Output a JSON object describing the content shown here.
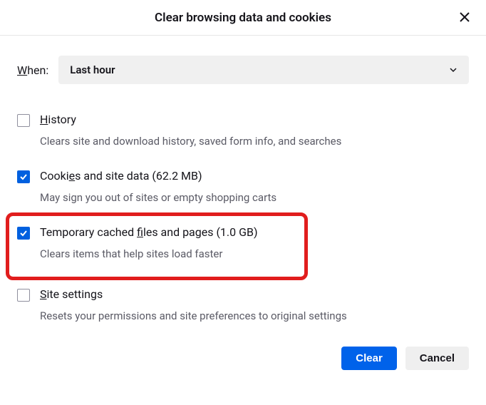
{
  "dialog": {
    "title": "Clear browsing data and cookies"
  },
  "when": {
    "label_pre": "W",
    "label_post": "hen:",
    "selected": "Last hour"
  },
  "options": {
    "history": {
      "underline": "H",
      "rest": "istory",
      "desc": "Clears site and download history, saved form info, and searches"
    },
    "cookies": {
      "pre": "Cooki",
      "underline": "e",
      "post": "s and site data (62.2 MB)",
      "desc": "May sign you out of sites or empty shopping carts"
    },
    "cache": {
      "pre": "Temporary cached ",
      "underline": "f",
      "post": "iles and pages (1.0 GB)",
      "desc": "Clears items that help sites load faster"
    },
    "site": {
      "underline": "S",
      "rest": "ite settings",
      "desc": "Resets your permissions and site preferences to original settings"
    }
  },
  "buttons": {
    "clear": "Clear",
    "cancel": "Cancel"
  }
}
